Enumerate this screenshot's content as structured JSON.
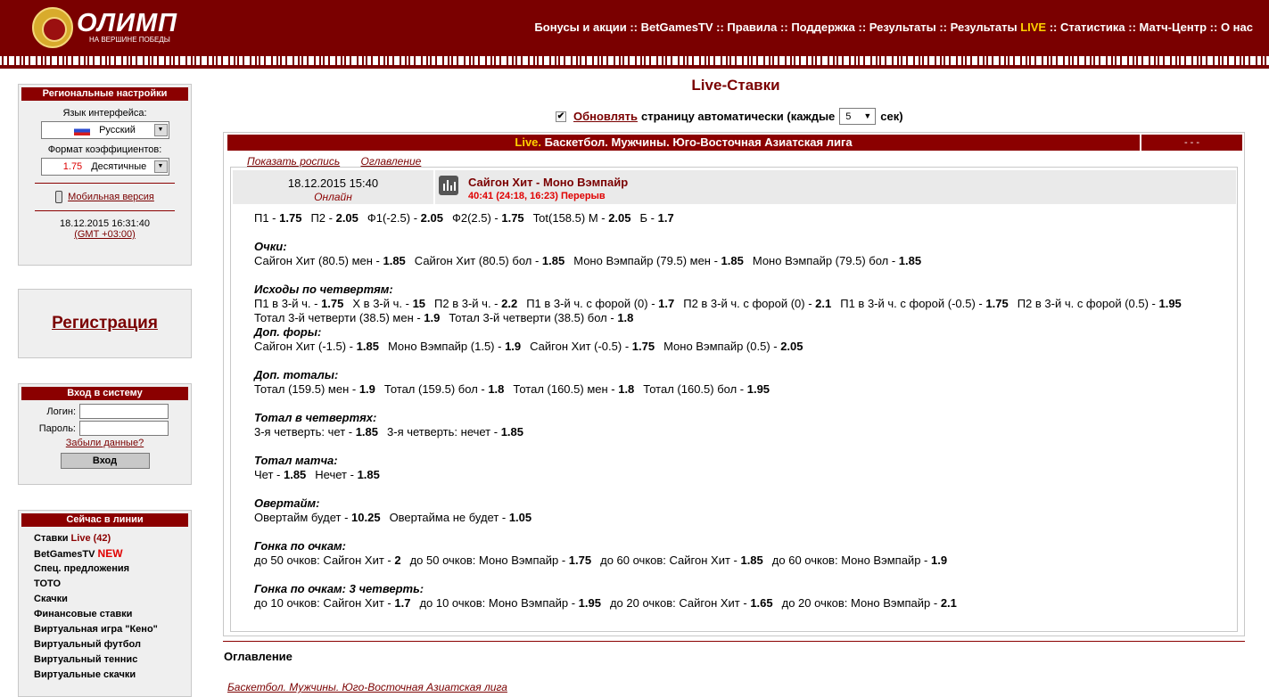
{
  "header": {
    "logo_text": "ОЛИМП",
    "logo_sub": "НА ВЕРШИНЕ ПОБЕДЫ",
    "nav": [
      {
        "label": "Бонусы и акции",
        "live": false
      },
      {
        "label": "BetGamesTV",
        "live": false
      },
      {
        "label": "Правила",
        "live": false
      },
      {
        "label": "Поддержка",
        "live": false
      },
      {
        "label": "Результаты",
        "live": false
      },
      {
        "label": "Результаты ",
        "live_suffix": "LIVE"
      },
      {
        "label": "Статистика",
        "live": false
      },
      {
        "label": "Матч-Центр",
        "live": false
      },
      {
        "label": "О нас",
        "live": false
      }
    ],
    "separator": " :: "
  },
  "sidebar": {
    "regional": {
      "title": "Региональные настройки",
      "language_label": "Язык интерфейса:",
      "language_value": "Русский",
      "format_label": "Формат коэффициентов:",
      "format_example": "1.75",
      "format_value": "Десятичные",
      "mobile_link": "Мобильная версия",
      "datetime": "18.12.2015 16:31:40",
      "timezone": "(GMT +03:00)"
    },
    "registration": "Регистрация",
    "login": {
      "title": "Вход в систему",
      "login_label": "Логин:",
      "password_label": "Пароль:",
      "forgot": "Забыли данные?",
      "button": "Вход"
    },
    "lines": {
      "title": "Сейчас в линии",
      "items": [
        {
          "label": "Ставки ",
          "live": "Live",
          "count": " (42)"
        },
        {
          "label": "BetGamesTV ",
          "new": "NEW"
        },
        {
          "label": "Спец. предложения"
        },
        {
          "label": "ТОТО"
        },
        {
          "label": "Скачки"
        },
        {
          "label": "Финансовые ставки"
        },
        {
          "label": "Виртуальная игра \"Кено\""
        },
        {
          "label": "Виртуальный футбол"
        },
        {
          "label": "Виртуальный теннис"
        },
        {
          "label": "Виртуальные скачки"
        }
      ]
    }
  },
  "main": {
    "title": "Live-Ставки",
    "refresh": {
      "link": "Обновлять",
      "text": "страницу автоматически (каждые",
      "interval": "5",
      "suffix": "сек)"
    },
    "league": {
      "live_label": "Live.",
      "name": " Баскетбол. Мужчины. Юго-Восточная Азиатская лига",
      "dash": "- - -"
    },
    "sublinks": [
      "Показать роспись",
      "Оглавление"
    ],
    "event": {
      "date": "18.12.2015 15:40",
      "status": "Онлайн",
      "teams": "Сайгон Хит - Моно Вэмпайр",
      "score": "40:41 (24:18, 16:23) Перерыв",
      "main_odds": [
        {
          "l": "П1 - ",
          "v": "1.75"
        },
        {
          "l": "П2 - ",
          "v": "2.05"
        },
        {
          "l": "Ф1(-2.5) - ",
          "v": "2.05"
        },
        {
          "l": "Ф2(2.5) - ",
          "v": "1.75"
        },
        {
          "l": "Tot(158.5) М - ",
          "v": "2.05"
        },
        {
          "l": "Б - ",
          "v": "1.7"
        }
      ],
      "groups": [
        {
          "title": "Очки:",
          "lines": [
            [
              {
                "l": "Сайгон Хит (80.5) мен - ",
                "v": "1.85"
              },
              {
                "l": "Сайгон Хит (80.5) бол - ",
                "v": "1.85"
              },
              {
                "l": "Моно Вэмпайр (79.5) мен - ",
                "v": "1.85"
              },
              {
                "l": "Моно Вэмпайр (79.5) бол - ",
                "v": "1.85"
              }
            ]
          ]
        },
        {
          "title": "Исходы по четвертям:",
          "lines": [
            [
              {
                "l": "П1 в 3-й ч. - ",
                "v": "1.75"
              },
              {
                "l": "Х в 3-й ч. - ",
                "v": "15"
              },
              {
                "l": "П2 в 3-й ч. - ",
                "v": "2.2"
              },
              {
                "l": "П1 в 3-й ч. с форой (0) - ",
                "v": "1.7"
              },
              {
                "l": "П2 в 3-й ч. с форой (0) - ",
                "v": "2.1"
              },
              {
                "l": "П1 в 3-й ч. с форой (-0.5) - ",
                "v": "1.75"
              },
              {
                "l": "П2 в 3-й ч. с форой (0.5) - ",
                "v": "1.95"
              }
            ],
            [
              {
                "l": "Тотал 3-й четверти (38.5) мен - ",
                "v": "1.9"
              },
              {
                "l": "Тотал 3-й четверти (38.5) бол - ",
                "v": "1.8"
              }
            ]
          ]
        },
        {
          "title": "Доп. форы:",
          "lines": [
            [
              {
                "l": "Сайгон Хит (-1.5) - ",
                "v": "1.85"
              },
              {
                "l": "Моно Вэмпайр (1.5) - ",
                "v": "1.9"
              },
              {
                "l": "Сайгон Хит (-0.5) - ",
                "v": "1.75"
              },
              {
                "l": "Моно Вэмпайр (0.5) - ",
                "v": "2.05"
              }
            ]
          ]
        },
        {
          "title": "Доп. тоталы:",
          "lines": [
            [
              {
                "l": "Тотал (159.5) мен - ",
                "v": "1.9"
              },
              {
                "l": "Тотал (159.5) бол - ",
                "v": "1.8"
              },
              {
                "l": "Тотал (160.5) мен - ",
                "v": "1.8"
              },
              {
                "l": "Тотал (160.5) бол - ",
                "v": "1.95"
              }
            ]
          ]
        },
        {
          "title": "Тотал в четвертях:",
          "lines": [
            [
              {
                "l": "3-я четверть: чет - ",
                "v": "1.85"
              },
              {
                "l": "3-я четверть: нечет - ",
                "v": "1.85"
              }
            ]
          ]
        },
        {
          "title": "Тотал матча:",
          "lines": [
            [
              {
                "l": "Чет - ",
                "v": "1.85"
              },
              {
                "l": "Нечет - ",
                "v": "1.85"
              }
            ]
          ]
        },
        {
          "title": "Овертайм:",
          "lines": [
            [
              {
                "l": "Овертайм будет - ",
                "v": "10.25"
              },
              {
                "l": "Овертайма не будет - ",
                "v": "1.05"
              }
            ]
          ]
        },
        {
          "title": "Гонка по очкам:",
          "lines": [
            [
              {
                "l": "до 50 очков: Сайгон Хит - ",
                "v": "2"
              },
              {
                "l": "до 50 очков: Моно Вэмпайр - ",
                "v": "1.75"
              },
              {
                "l": "до 60 очков: Сайгон Хит - ",
                "v": "1.85"
              },
              {
                "l": "до 60 очков: Моно Вэмпайр - ",
                "v": "1.9"
              }
            ]
          ]
        },
        {
          "title": "Гонка по очкам: 3 четверть:",
          "lines": [
            [
              {
                "l": "до 10 очков: Сайгон Хит - ",
                "v": "1.7"
              },
              {
                "l": "до 10 очков: Моно Вэмпайр - ",
                "v": "1.95"
              },
              {
                "l": "до 20 очков: Сайгон Хит - ",
                "v": "1.65"
              },
              {
                "l": "до 20 очков: Моно Вэмпайр - ",
                "v": "2.1"
              }
            ]
          ]
        }
      ]
    },
    "toc_title": "Оглавление",
    "toc_link": "Баскетбол. Мужчины. Юго-Восточная Азиатская лига"
  }
}
